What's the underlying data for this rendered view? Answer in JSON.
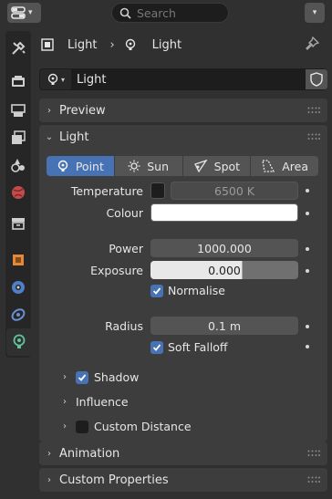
{
  "search": {
    "placeholder": "Search"
  },
  "breadcrumb": {
    "object": "Light",
    "data": "Light"
  },
  "datablock": {
    "name": "Light"
  },
  "panels": {
    "preview": "Preview",
    "light": "Light",
    "animation": "Animation",
    "custom_properties": "Custom Properties"
  },
  "light": {
    "types": [
      "Point",
      "Sun",
      "Spot",
      "Area"
    ],
    "selected_type": "Point",
    "temperature_label": "Temperature",
    "temperature_value": "6500 K",
    "colour_label": "Colour",
    "colour_value": "#ffffff",
    "power_label": "Power",
    "power_value": "1000.000",
    "exposure_label": "Exposure",
    "exposure_value": "0.000",
    "normalise_label": "Normalise",
    "normalise_checked": true,
    "radius_label": "Radius",
    "radius_value": "0.1 m",
    "soft_falloff_label": "Soft Falloff",
    "soft_falloff_checked": true
  },
  "subpanels": {
    "shadow": "Shadow",
    "shadow_checked": true,
    "influence": "Influence",
    "custom_distance": "Custom Distance",
    "custom_distance_checked": false
  },
  "colors": {
    "accent": "#4772b3",
    "panel": "#3d3d3d",
    "background": "#303030",
    "field": "#545454",
    "dark_field": "#1d1d1d"
  }
}
